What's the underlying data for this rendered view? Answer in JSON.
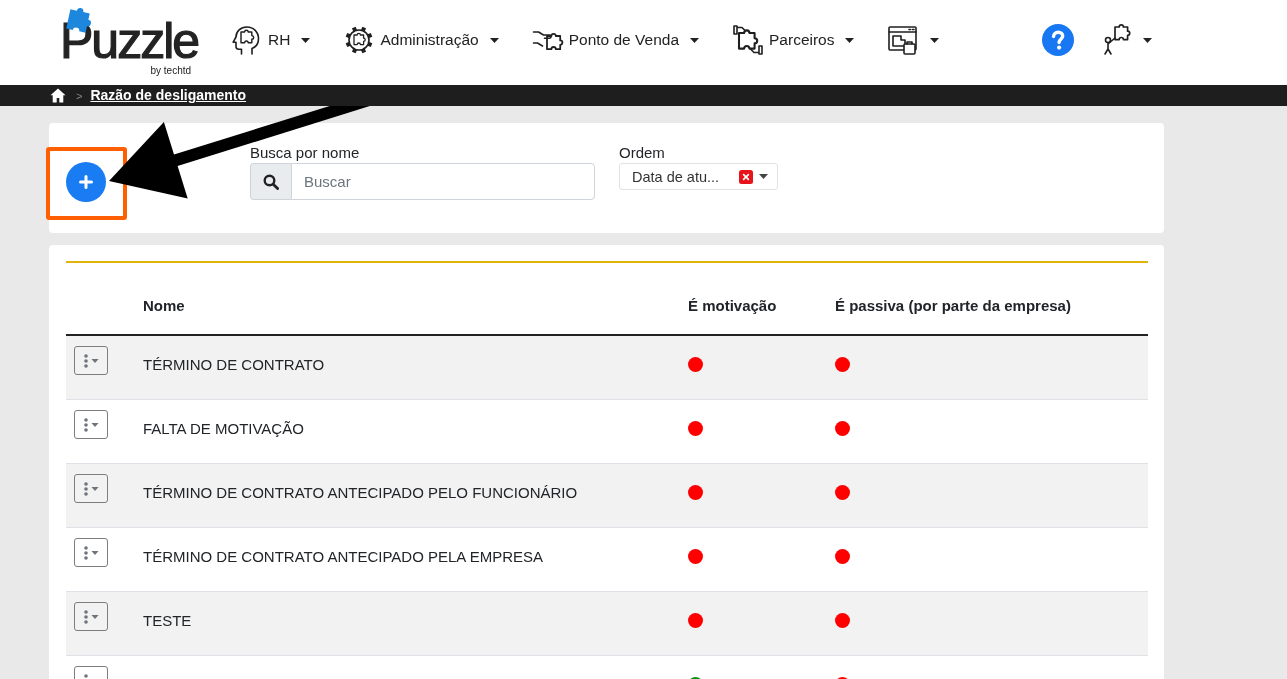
{
  "header": {
    "logo": {
      "wordmark": "Puzzle",
      "tagline": "by techtd"
    },
    "nav": [
      {
        "label": "RH",
        "has_menu": true
      },
      {
        "label": "Administração",
        "has_menu": true
      },
      {
        "label": "Ponto de Venda",
        "has_menu": true
      },
      {
        "label": "Parceiros",
        "has_menu": true
      },
      {
        "has_menu": true
      }
    ],
    "user_menu": {
      "has_menu": true
    }
  },
  "breadcrumb": {
    "separator": ">",
    "items": [
      "Razão de desligamento"
    ]
  },
  "filters": {
    "add_button": {
      "highlighted": true,
      "pointed_at": true
    },
    "search": {
      "label": "Busca por nome",
      "placeholder": "Buscar"
    },
    "order": {
      "label": "Ordem",
      "value": "Data de atu..."
    }
  },
  "table": {
    "columns": [
      "Nome",
      "É motivação",
      "É passiva (por parte da empresa)"
    ],
    "rows": [
      {
        "name": "TÉRMINO DE CONTRATO",
        "motivation": false,
        "passive": false
      },
      {
        "name": "FALTA DE MOTIVAÇÃO",
        "motivation": false,
        "passive": false
      },
      {
        "name": "TÉRMINO DE CONTRATO ANTECIPADO PELO FUNCIONÁRIO",
        "motivation": false,
        "passive": false
      },
      {
        "name": "TÉRMINO DE CONTRATO ANTECIPADO PELA EMPRESA",
        "motivation": false,
        "passive": false
      },
      {
        "name": "TESTE",
        "motivation": false,
        "passive": false
      },
      {
        "motivation": true,
        "passive": false
      }
    ]
  }
}
